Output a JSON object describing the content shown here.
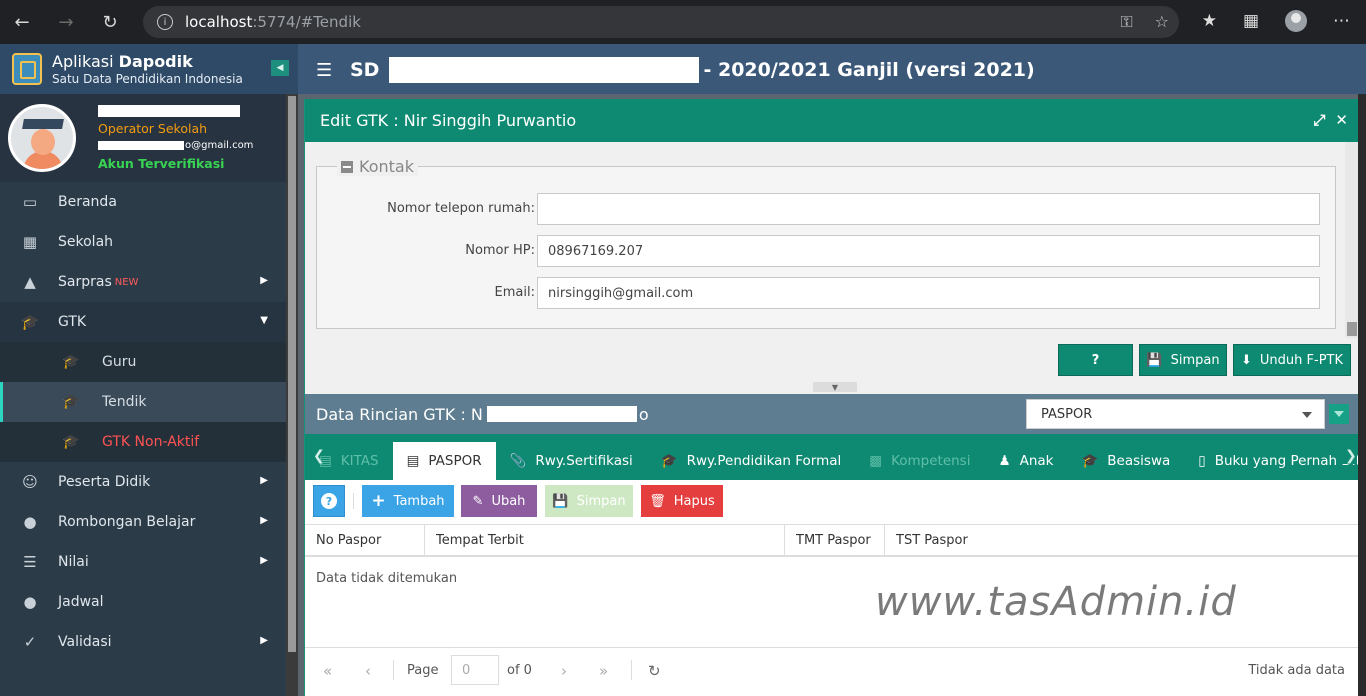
{
  "browser": {
    "url_host": "localhost",
    "url_path": ":5774/#Tendik"
  },
  "app": {
    "brand_prefix": "Aplikasi ",
    "brand_name": "Dapodik",
    "brand_sub": "Satu Data Pendidikan Indonesia",
    "school_prefix": "SD",
    "school_suffix": "- 2020/2021 Ganjil (versi 2021)"
  },
  "user": {
    "role": "Operator Sekolah",
    "email_suffix": "o@gmail.com",
    "status": "Akun Terverifikasi"
  },
  "sidebar": {
    "items": [
      {
        "label": "Beranda",
        "icon": "monitor-icon"
      },
      {
        "label": "Sekolah",
        "icon": "building-icon"
      },
      {
        "label": "Sarpras",
        "badge": "NEW",
        "icon": "road-icon"
      },
      {
        "label": "GTK",
        "icon": "graduation-cap-icon"
      },
      {
        "label": "Peserta Didik",
        "icon": "smile-icon"
      },
      {
        "label": "Rombongan Belajar",
        "icon": "users-icon"
      },
      {
        "label": "Nilai",
        "icon": "list-icon"
      },
      {
        "label": "Jadwal",
        "icon": "users-icon"
      },
      {
        "label": "Validasi",
        "icon": "check-icon"
      }
    ],
    "gtk_sub": [
      {
        "label": "Guru"
      },
      {
        "label": "Tendik"
      },
      {
        "label": "GTK Non-Aktif"
      }
    ]
  },
  "modal": {
    "title": "Edit GTK : Nir Singgih Purwantio",
    "section": "Kontak",
    "fields": [
      {
        "label": "Nomor telepon rumah:",
        "value": ""
      },
      {
        "label": "Nomor HP:",
        "value": "08967169.207"
      },
      {
        "label": "Email:",
        "value": "nirsinggih@gmail.com"
      }
    ],
    "buttons": {
      "help": "?",
      "save": "Simpan",
      "download": "Unduh F-PTK"
    }
  },
  "rincian": {
    "title": "Data Rincian GTK : N",
    "title_tail": "o",
    "select_value": "PASPOR"
  },
  "tabs": [
    {
      "label": "KITAS",
      "state": "disabled"
    },
    {
      "label": "PASPOR",
      "state": "active"
    },
    {
      "label": "Rwy.Sertifikasi",
      "state": "normal"
    },
    {
      "label": "Rwy.Pendidikan Formal",
      "state": "normal"
    },
    {
      "label": "Kompetensi",
      "state": "disabled"
    },
    {
      "label": "Anak",
      "state": "normal"
    },
    {
      "label": "Beasiswa",
      "state": "normal"
    },
    {
      "label": "Buku yang Pernah Ditul",
      "state": "normal"
    }
  ],
  "actions": {
    "help": "?",
    "add": "Tambah",
    "edit": "Ubah",
    "save": "Simpan",
    "delete": "Hapus"
  },
  "table": {
    "columns": [
      "No Paspor",
      "Tempat Terbit",
      "TMT Paspor",
      "TST Paspor"
    ],
    "empty_text": "Data tidak ditemukan"
  },
  "watermark": "www.tasAdmin.id",
  "pager": {
    "page_label": "Page",
    "page_value": "0",
    "of_label": "of 0",
    "status": "Tidak ada data"
  },
  "colors": {
    "teal": "#0f8a72",
    "header": "#3b5878",
    "sidebar": "#2c3b48",
    "blue_btn": "#3ba4e6",
    "purple_btn": "#8e5da0",
    "red_btn": "#e53e3e"
  }
}
